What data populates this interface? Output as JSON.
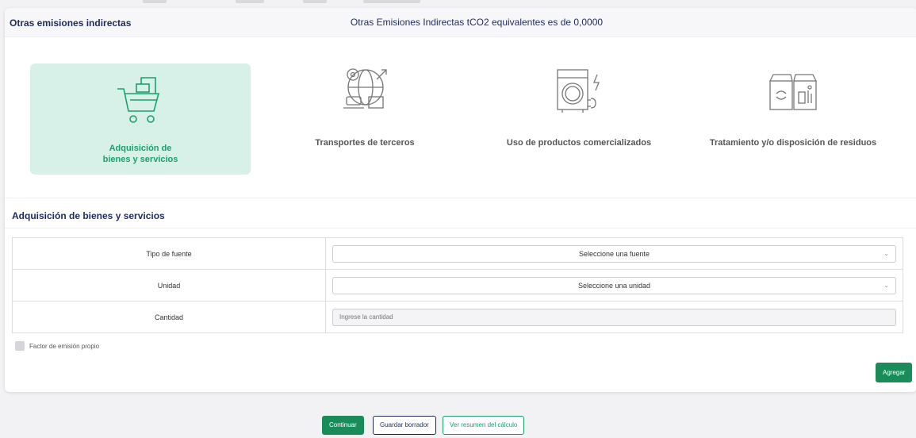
{
  "card": {
    "title": "Otras emisiones indirectas",
    "total": "Otras Emisiones Indirectas tCO2 equivalentes es de 0,0000"
  },
  "categories": [
    {
      "label_line1": "Adquisición de",
      "label_line2": "bienes y servicios",
      "icon": "shopping-cart-icon",
      "active": true
    },
    {
      "label": "Transportes de terceros",
      "icon": "transport-globe-icon",
      "active": false
    },
    {
      "label": "Uso de productos comercializados",
      "icon": "washing-machine-icon",
      "active": false
    },
    {
      "label": "Tratamiento y/o disposición de residuos",
      "icon": "recycle-bins-icon",
      "active": false
    }
  ],
  "section": {
    "title": "Adquisición de bienes y servicios"
  },
  "form": {
    "tipo_fuente_label": "Tipo de fuente",
    "tipo_fuente_value": "Seleccione una fuente",
    "unidad_label": "Unidad",
    "unidad_value": "Seleccione una unidad",
    "cantidad_label": "Cantidad",
    "cantidad_placeholder": "Ingrese la cantidad",
    "factor_label": "Factor de emisión propio",
    "agregar": "Agregar"
  },
  "footer": {
    "continuar": "Continuar",
    "guardar": "Guardar borrador",
    "resumen": "Ver resumen del cálculo"
  },
  "colors": {
    "accent_green": "#1a8c5a",
    "active_bg": "#d8f1e8",
    "navy": "#1f2a5c"
  }
}
